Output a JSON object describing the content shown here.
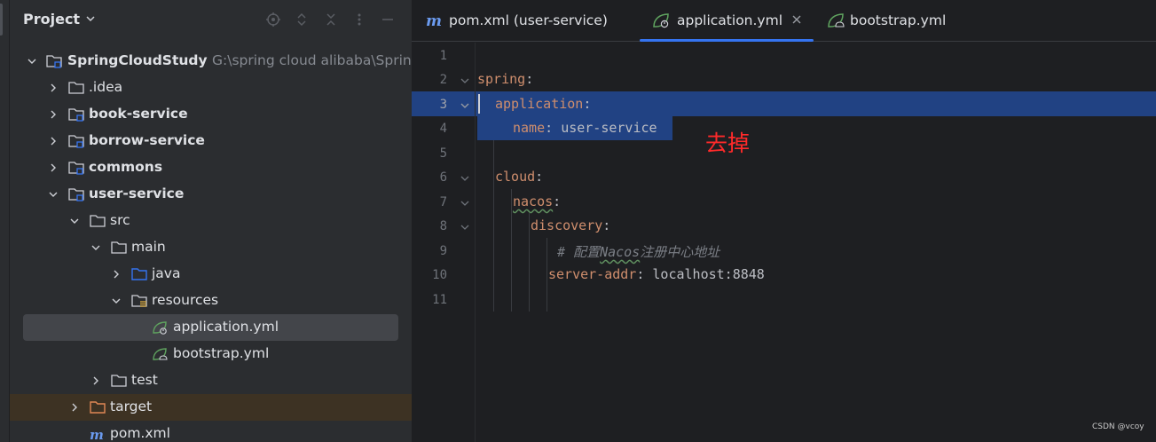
{
  "panel": {
    "title": "Project"
  },
  "tree": {
    "root": {
      "name": "SpringCloudStudy",
      "path": "G:\\spring cloud alibaba\\Sprin"
    },
    "items": [
      {
        "label": ".idea"
      },
      {
        "label": "book-service"
      },
      {
        "label": "borrow-service"
      },
      {
        "label": "commons"
      },
      {
        "label": "user-service"
      },
      {
        "label": "src"
      },
      {
        "label": "main"
      },
      {
        "label": "java"
      },
      {
        "label": "resources"
      },
      {
        "label": "application.yml"
      },
      {
        "label": "bootstrap.yml"
      },
      {
        "label": "test"
      },
      {
        "label": "target"
      },
      {
        "label": "pom.xml"
      }
    ]
  },
  "tabs": [
    {
      "label": "pom.xml (user-service)",
      "icon": "maven-icon"
    },
    {
      "label": "application.yml",
      "icon": "spring-yml-icon",
      "active": true
    },
    {
      "label": "bootstrap.yml",
      "icon": "spring-yml-icon"
    }
  ],
  "editor": {
    "line_numbers": [
      "1",
      "2",
      "3",
      "4",
      "5",
      "6",
      "7",
      "8",
      "9",
      "10",
      "11"
    ],
    "lines": {
      "l2_key": "spring",
      "l3_key": "application",
      "l4_key": "name",
      "l4_val": "user-service",
      "l6_key": "cloud",
      "l7_key": "nacos",
      "l8_key": "discovery",
      "l9_comment_a": "# 配置",
      "l9_comment_b": "Nacos",
      "l9_comment_c": "注册中心地址",
      "l10_key": "server-addr",
      "l10_val": "localhost:8848",
      "colon": ":",
      "colon_sp": ": "
    }
  },
  "annotation": "去掉",
  "watermark": "CSDN @vcoy",
  "colors": {
    "accent": "#3574f0",
    "selection": "#214283",
    "annotation": "#ff2a2a",
    "yaml_key": "#cf8e6d"
  }
}
